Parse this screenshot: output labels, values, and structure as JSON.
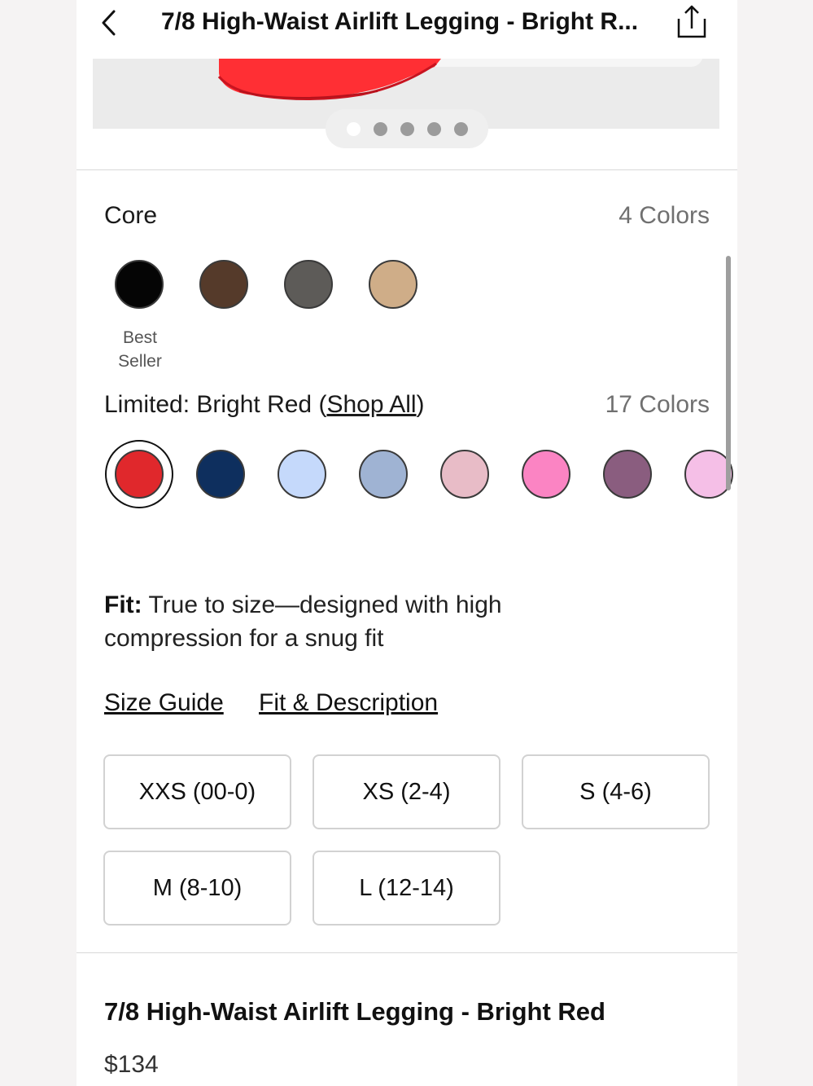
{
  "header": {
    "title": "7/8 High-Waist Airlift Legging - Bright R...",
    "back_icon": "chevron-left-icon",
    "share_icon": "share-icon"
  },
  "carousel": {
    "dot_count": 5,
    "active_index": 0
  },
  "core": {
    "label": "Core",
    "count": "4 Colors",
    "swatches": [
      {
        "name": "black",
        "color": "#050505"
      },
      {
        "name": "brown",
        "color": "#553a2a"
      },
      {
        "name": "gray",
        "color": "#5d5b58"
      },
      {
        "name": "tan",
        "color": "#cfad88"
      }
    ],
    "badge": {
      "line1": "Best",
      "line2": "Seller"
    }
  },
  "limited": {
    "label_prefix": "Limited: Bright Red (",
    "shop_all": "Shop All",
    "label_suffix": ")",
    "count": "17 Colors",
    "swatches": [
      {
        "name": "bright-red",
        "color": "#e0282c",
        "selected": true
      },
      {
        "name": "navy",
        "color": "#0e2f5e"
      },
      {
        "name": "light-blue",
        "color": "#c5d9fb"
      },
      {
        "name": "dusty-blue",
        "color": "#9fb3d3"
      },
      {
        "name": "light-pink",
        "color": "#e8bcc7"
      },
      {
        "name": "hot-pink",
        "color": "#fb84c3"
      },
      {
        "name": "plum",
        "color": "#8a5d7f"
      },
      {
        "name": "pastel-pink",
        "color": "#f5bfe7"
      }
    ]
  },
  "fit": {
    "label": "Fit:",
    "text": "True to size—designed with high compression for a snug fit"
  },
  "links": {
    "size_guide": "Size Guide",
    "fit_description": "Fit & Description"
  },
  "sizes": [
    "XXS (00-0)",
    "XS (2-4)",
    "S (4-6)",
    "M (8-10)",
    "L (12-14)"
  ],
  "product": {
    "name": "7/8 High-Waist Airlift Legging - Bright Red",
    "price": "$134"
  },
  "colors": {
    "accent_red": "#ff2a2a"
  }
}
